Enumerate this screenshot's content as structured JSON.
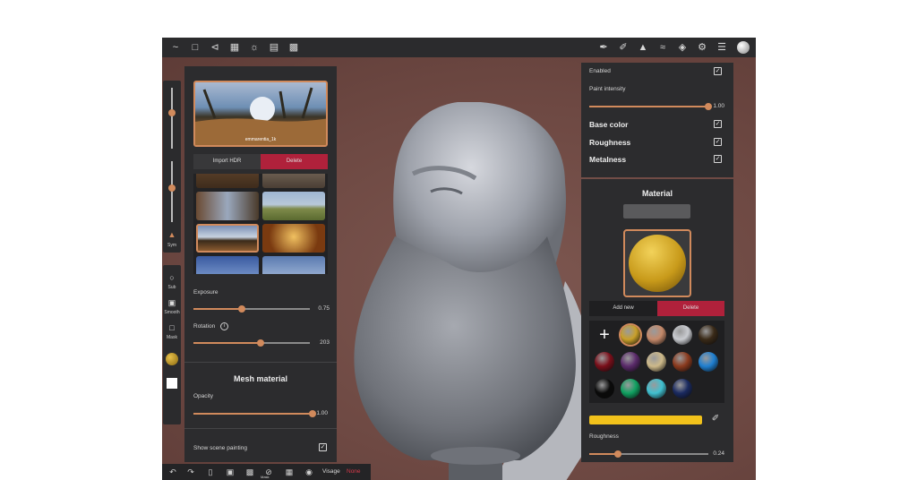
{
  "toolbar": {
    "left_icons": [
      "app-logo-icon",
      "folder-icon",
      "scene-icon",
      "grid-icon",
      "light-icon",
      "image-icon",
      "camera-icon"
    ],
    "right_icons": [
      "brush-icon",
      "pen-icon",
      "triangle-icon",
      "stroke-icon",
      "layers-icon",
      "gear-icon",
      "sliders-icon",
      "avatar-icon"
    ]
  },
  "left_strip": {
    "sym_label": "Sym",
    "sub_label": "Sub",
    "smooth_label": "Smooth",
    "mask_label": "Mask",
    "slider1_value": 0.72,
    "slider2_value": 0.52
  },
  "environment": {
    "preview_caption": "emmarentia_1k",
    "import_label": "Import HDR",
    "delete_label": "Delete",
    "exposure_label": "Exposure",
    "exposure_value": "0.75",
    "rotation_label": "Rotation",
    "rotation_value": "203"
  },
  "mesh_material": {
    "title": "Mesh material",
    "opacity_label": "Opacity",
    "opacity_value": "1.00",
    "scene_painting_label": "Show scene painting"
  },
  "paint": {
    "enabled_label": "Enabled",
    "intensity_label": "Paint intensity",
    "intensity_value": "1.00",
    "base_color_label": "Base color",
    "roughness_label": "Roughness",
    "metalness_label": "Metalness"
  },
  "material": {
    "title": "Material",
    "add_new_label": "Add new",
    "delete_label": "Delete",
    "roughness_label": "Roughness",
    "roughness_value": "0.24",
    "add_symbol": "+",
    "swatch_colors": [
      "#c9a02a",
      "#c4896a",
      "#c9cbd0",
      "#3a2a18",
      "#7a0f1a",
      "#5a2a6a",
      "#cdb98a",
      "#8a3a1e",
      "#1f7fd0",
      "#0a0a0a",
      "#10a060",
      "#40c0d0",
      "#1a2a60"
    ],
    "bar_color": "#f2c21b"
  },
  "bottom_bar": {
    "mask_label": "Mask",
    "visage_label": "Visage",
    "none_label": "None"
  },
  "colors": {
    "accent": "#d18a5c",
    "delete_red": "#b0213b",
    "panel": "#2c2c2e"
  }
}
